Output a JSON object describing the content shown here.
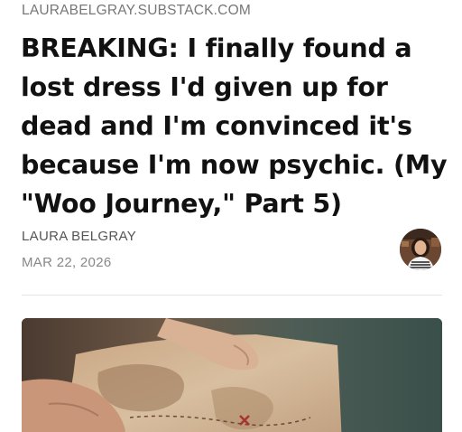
{
  "publication": {
    "name": "LAURABELGRAY.SUBSTACK.COM"
  },
  "post": {
    "title": "BREAKING: I finally found a lost dress I'd given up for dead and I'm convinced it's because I'm now psychic. (My \"Woo Journey,\" Part 5)",
    "author": "LAURA BELGRAY",
    "date": "MAR 22, 2026"
  },
  "icons": {
    "avatar": "author-avatar-photo",
    "hero": "hero-image-treasure-map"
  }
}
